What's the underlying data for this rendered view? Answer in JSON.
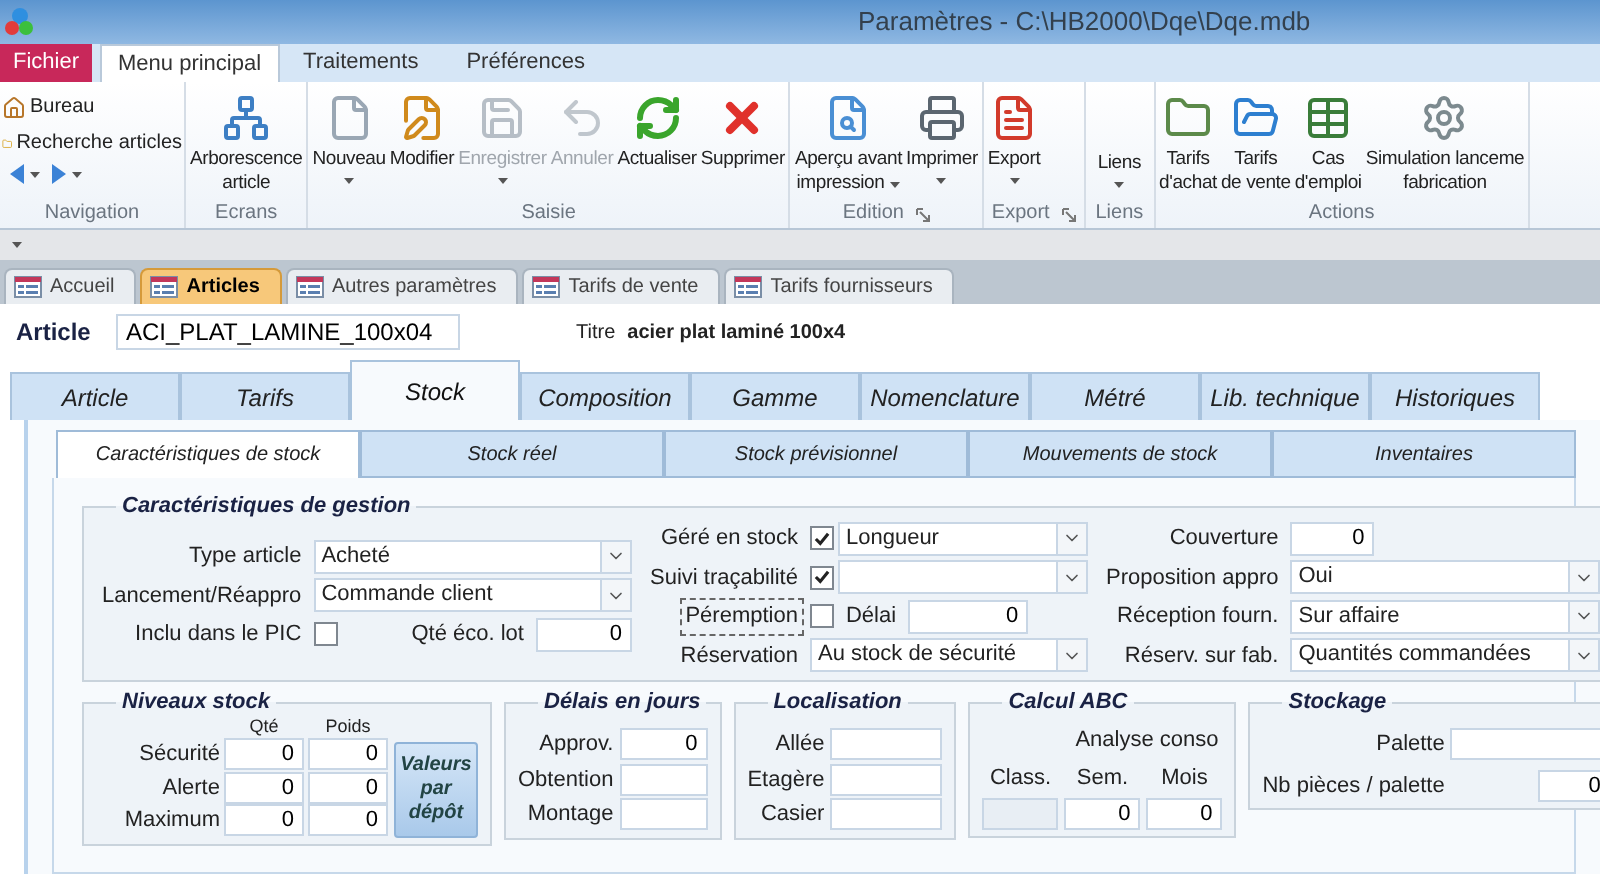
{
  "window": {
    "title": "Paramètres - C:\\HB2000\\Dqe\\Dqe.mdb"
  },
  "ribbon_tabs": [
    {
      "label": "Fichier",
      "kind": "file",
      "selected": false
    },
    {
      "label": "Menu principal",
      "kind": "tab",
      "selected": true
    },
    {
      "label": "Traitements",
      "kind": "tab",
      "selected": false
    },
    {
      "label": "Préférences",
      "kind": "tab",
      "selected": false
    }
  ],
  "ribbon_groups": [
    {
      "label": "Navigation",
      "kind": "navigation",
      "items": [
        "Bureau",
        "Recherche articles"
      ]
    },
    {
      "label": "Ecrans",
      "kind": "buttons",
      "buttons": [
        {
          "lines": [
            "Arborescence",
            "article"
          ],
          "disabled": false,
          "dropdown": false
        }
      ]
    },
    {
      "label": "Saisie",
      "kind": "buttons",
      "buttons": [
        {
          "lines": [
            "Nouveau"
          ],
          "disabled": false,
          "dropdown": true
        },
        {
          "lines": [
            "Modifier"
          ],
          "disabled": false,
          "dropdown": false
        },
        {
          "lines": [
            "Enregistrer"
          ],
          "disabled": true,
          "dropdown": true
        },
        {
          "lines": [
            "Annuler"
          ],
          "disabled": true,
          "dropdown": false
        },
        {
          "lines": [
            "Actualiser"
          ],
          "disabled": false,
          "dropdown": false
        },
        {
          "lines": [
            "Supprimer"
          ],
          "disabled": false,
          "dropdown": false
        }
      ]
    },
    {
      "label": "Edition",
      "kind": "buttons",
      "launcher": true,
      "buttons": [
        {
          "lines": [
            "Aperçu avant",
            "impression"
          ],
          "disabled": false,
          "dropdown": true
        },
        {
          "lines": [
            "Imprimer"
          ],
          "disabled": false,
          "dropdown": true
        }
      ]
    },
    {
      "label": "Export",
      "kind": "buttons",
      "launcher": true,
      "buttons": [
        {
          "lines": [
            "Export"
          ],
          "disabled": false,
          "dropdown": true
        }
      ]
    },
    {
      "label": "Liens",
      "kind": "text_buttons",
      "buttons": [
        {
          "lines": [
            "Liens"
          ],
          "disabled": false,
          "dropdown": true
        }
      ]
    },
    {
      "label": "Actions",
      "kind": "buttons",
      "buttons": [
        {
          "lines": [
            "Tarifs",
            "d'achat"
          ],
          "disabled": false,
          "dropdown": false
        },
        {
          "lines": [
            "Tarifs",
            "de vente"
          ],
          "disabled": false,
          "dropdown": false
        },
        {
          "lines": [
            "Cas",
            "d'emploi"
          ],
          "disabled": false,
          "dropdown": false
        },
        {
          "lines": [
            "Simulation lanceme",
            "fabrication"
          ],
          "disabled": false,
          "dropdown": false
        }
      ]
    }
  ],
  "document_tabs": [
    {
      "label": "Accueil",
      "selected": false
    },
    {
      "label": "Articles",
      "selected": true
    },
    {
      "label": "Autres paramètres",
      "selected": false
    },
    {
      "label": "Tarifs de vente",
      "selected": false
    },
    {
      "label": "Tarifs fournisseurs",
      "selected": false
    }
  ],
  "article": {
    "label": "Article",
    "value": "ACI_PLAT_LAMINE_100x04",
    "title_label": "Titre",
    "title_value": "acier plat laminé 100x4"
  },
  "main_tabs": [
    {
      "label": "Article",
      "selected": false
    },
    {
      "label": "Tarifs",
      "selected": false
    },
    {
      "label": "Stock",
      "selected": true
    },
    {
      "label": "Composition",
      "selected": false
    },
    {
      "label": "Gamme",
      "selected": false
    },
    {
      "label": "Nomenclature",
      "selected": false
    },
    {
      "label": "Métré",
      "selected": false
    },
    {
      "label": "Lib. technique",
      "selected": false
    },
    {
      "label": "Historiques",
      "selected": false
    }
  ],
  "sub_tabs": [
    {
      "label": "Caractéristiques de stock",
      "selected": true
    },
    {
      "label": "Stock réel",
      "selected": false
    },
    {
      "label": "Stock prévisionnel",
      "selected": false
    },
    {
      "label": "Mouvements de stock",
      "selected": false
    },
    {
      "label": "Inventaires",
      "selected": false
    }
  ],
  "gestion": {
    "title": "Caractéristiques de gestion",
    "columns": [
      [
        {
          "kind": "combo",
          "label": "Type article",
          "value": "Acheté"
        },
        {
          "kind": "combo",
          "label": "Lancement/Réappro",
          "value": "Commande client"
        },
        {
          "kind": "check_text",
          "label": "Inclu dans le PIC",
          "checked": false,
          "focused": false,
          "label2": "Qté éco. lot",
          "value": "0"
        }
      ],
      [
        {
          "kind": "check_combo",
          "label": "Géré en stock",
          "checked": true,
          "value": "Longueur"
        },
        {
          "kind": "check_combo",
          "label": "Suivi traçabilité",
          "checked": true
        },
        {
          "kind": "check_text",
          "label": "Péremption",
          "checked": false,
          "focused": true,
          "label2": "Délai",
          "value": "0"
        },
        {
          "kind": "combo",
          "label": "Réservation",
          "value": "Au stock de sécurité"
        }
      ],
      [
        {
          "kind": "text",
          "label": "Couverture",
          "value": "0"
        },
        {
          "kind": "combo",
          "label": "Proposition appro",
          "value": "Oui"
        },
        {
          "kind": "combo",
          "label": "Réception fourn.",
          "value": "Sur affaire"
        },
        {
          "kind": "combo",
          "label": "Réserv. sur fab.",
          "value": "Quantités commandées"
        }
      ]
    ]
  },
  "niveaux": {
    "title": "Niveaux stock",
    "columns": [
      "Qté",
      "Poids"
    ],
    "rows": [
      {
        "label": "Sécurité",
        "values": [
          "0",
          "0"
        ]
      },
      {
        "label": "Alerte",
        "values": [
          "0",
          "0"
        ]
      },
      {
        "label": "Maximum",
        "values": [
          "0",
          "0"
        ]
      }
    ],
    "button": "Valeurs par dépôt"
  },
  "delais": {
    "title": "Délais en jours",
    "fields": [
      {
        "label": "Approv.",
        "value": "0"
      },
      {
        "label": "Obtention"
      },
      {
        "label": "Montage"
      }
    ]
  },
  "localisation": {
    "title": "Localisation",
    "fields": [
      {
        "label": "Allée"
      },
      {
        "label": "Etagère"
      },
      {
        "label": "Casier"
      }
    ]
  },
  "abc": {
    "title": "Calcul ABC",
    "group_label": "Analyse conso",
    "columns": [
      {
        "label": "Class.",
        "disabled": true
      },
      {
        "label": "Sem.",
        "value": "0",
        "disabled": false
      },
      {
        "label": "Mois",
        "value": "0",
        "disabled": false
      }
    ]
  },
  "stockage": {
    "title": "Stockage",
    "fields": [
      {
        "label": "Palette"
      },
      {
        "label": "Nb pièces / palette",
        "value": "0"
      }
    ]
  }
}
